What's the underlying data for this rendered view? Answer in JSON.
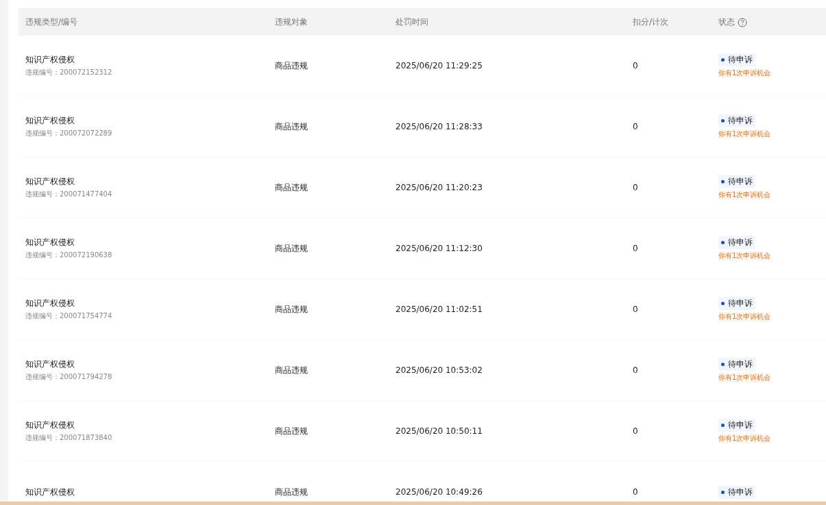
{
  "table": {
    "columns": [
      {
        "label": "违规类型/编号"
      },
      {
        "label": "违规对象"
      },
      {
        "label": "处罚时间"
      },
      {
        "label": "扣分/计次"
      },
      {
        "label": "状态",
        "help": true
      }
    ],
    "rows": [
      {
        "type": "知识产权侵权",
        "number": "违规编号：200072152312",
        "object": "商品违规",
        "time": "2025/06/20 11:29:25",
        "points": "0",
        "status": "待申诉",
        "hint": "你有1次申诉机会"
      },
      {
        "type": "知识产权侵权",
        "number": "违规编号：200072072289",
        "object": "商品违规",
        "time": "2025/06/20 11:28:33",
        "points": "0",
        "status": "待申诉",
        "hint": "你有1次申诉机会"
      },
      {
        "type": "知识产权侵权",
        "number": "违规编号：200071477404",
        "object": "商品违规",
        "time": "2025/06/20 11:20:23",
        "points": "0",
        "status": "待申诉",
        "hint": "你有1次申诉机会"
      },
      {
        "type": "知识产权侵权",
        "number": "违规编号：200072190638",
        "object": "商品违规",
        "time": "2025/06/20 11:12:30",
        "points": "0",
        "status": "待申诉",
        "hint": "你有1次申诉机会"
      },
      {
        "type": "知识产权侵权",
        "number": "违规编号：200071754774",
        "object": "商品违规",
        "time": "2025/06/20 11:02:51",
        "points": "0",
        "status": "待申诉",
        "hint": "你有1次申诉机会"
      },
      {
        "type": "知识产权侵权",
        "number": "违规编号：200071794278",
        "object": "商品违规",
        "time": "2025/06/20 10:53:02",
        "points": "0",
        "status": "待申诉",
        "hint": "你有1次申诉机会"
      },
      {
        "type": "知识产权侵权",
        "number": "违规编号：200071873840",
        "object": "商品违规",
        "time": "2025/06/20 10:50:11",
        "points": "0",
        "status": "待申诉",
        "hint": "你有1次申诉机会"
      },
      {
        "type": "知识产权侵权",
        "object": "商品违规",
        "time": "2025/06/20 10:49:26",
        "points": "0",
        "status": "待申诉"
      }
    ]
  }
}
